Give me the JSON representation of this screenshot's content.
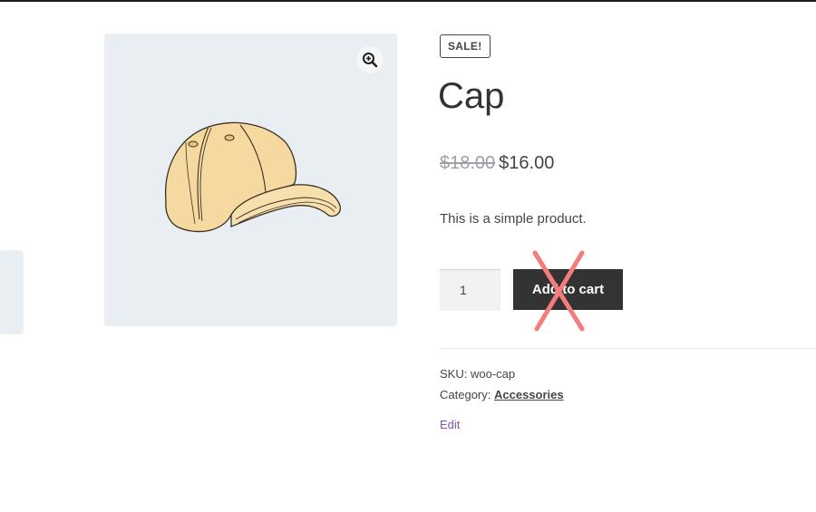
{
  "product": {
    "sale_badge": "SALE!",
    "title": "Cap",
    "regular_price": "$18.00",
    "sale_price": "$16.00",
    "description": "This is a simple product.",
    "quantity": "1",
    "add_to_cart_label": "Add to cart",
    "sku_label": "SKU:",
    "sku_value": "woo-cap",
    "category_label": "Category:",
    "category_value": "Accessories",
    "edit_label": "Edit"
  },
  "icons": {
    "zoom": "zoom-in-icon",
    "overlay": "red-x-mark"
  },
  "colors": {
    "button_bg": "#333333",
    "gallery_bg": "#e9eef3",
    "x_mark": "#f47c7c",
    "edit_link": "#7f54b3"
  }
}
